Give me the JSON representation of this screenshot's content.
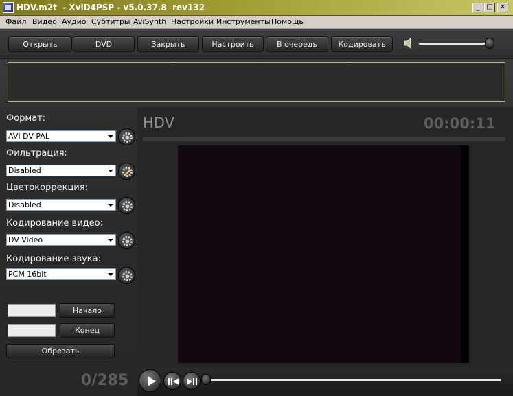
{
  "window": {
    "title": "HDV.m2t  - XviD4PSP - v5.0.37.8  rev132",
    "controls": [
      "_",
      "□",
      "✕"
    ]
  },
  "menu": [
    "Файл",
    "Видео",
    "Аудио",
    "Субтитры",
    "AviSynth",
    "Настройки",
    "Инструменты",
    "Помощь"
  ],
  "toolbar": {
    "open": "Открыть",
    "dvd": "DVD",
    "close": "Закрыть",
    "configure": "Настроить",
    "queue": "В очередь",
    "encode": "Кодировать",
    "volume_level": 0.95
  },
  "left": {
    "format_label": "Формат:",
    "format_value": "AVI DV PAL",
    "filter_label": "Фильтрация:",
    "filter_value": "Disabled",
    "color_label": "Цветокоррекция:",
    "color_value": "Disabled",
    "video_label": "Кодирование видео:",
    "video_value": "DV Video",
    "audio_label": "Кодирование звука:",
    "audio_value": "PCM 16bit",
    "start_label": "Начало",
    "end_label": "Конец",
    "cut_label": "Обрезать",
    "start_value": "",
    "end_value": "",
    "frame_counter": "0/285"
  },
  "preview": {
    "title": "HDV",
    "time": "00:00:11"
  },
  "playback": {
    "position": 0.0
  }
}
